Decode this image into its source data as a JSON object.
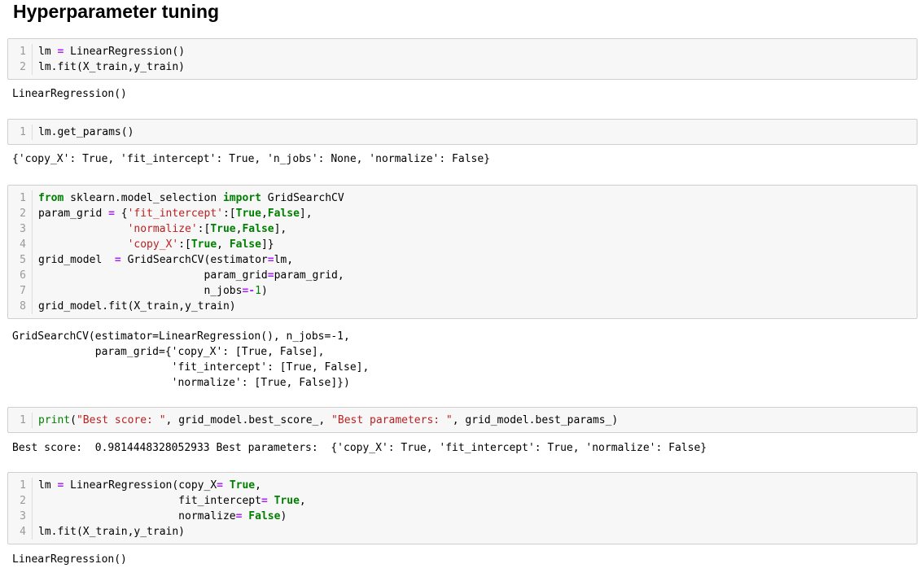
{
  "title": "Hyperparameter tuning",
  "cells": [
    {
      "lines": [
        [
          [
            "lm ",
            ""
          ],
          [
            "=",
            "op"
          ],
          [
            " LinearRegression()",
            ""
          ]
        ],
        [
          [
            "lm.fit(X_train,y_train)",
            ""
          ]
        ]
      ],
      "output": "LinearRegression()"
    },
    {
      "lines": [
        [
          [
            "lm.get_params()",
            ""
          ]
        ]
      ],
      "output": "{'copy_X': True, 'fit_intercept': True, 'n_jobs': None, 'normalize': False}"
    },
    {
      "lines": [
        [
          [
            "from",
            "kw"
          ],
          [
            " sklearn.model_selection ",
            ""
          ],
          [
            "import",
            "kw"
          ],
          [
            " GridSearchCV",
            ""
          ]
        ],
        [
          [
            "param_grid ",
            ""
          ],
          [
            "=",
            "op"
          ],
          [
            " {",
            ""
          ],
          [
            "'fit_intercept'",
            "str"
          ],
          [
            ":[",
            ""
          ],
          [
            "True",
            "kw"
          ],
          [
            ",",
            ""
          ],
          [
            "False",
            "kw"
          ],
          [
            "],",
            ""
          ]
        ],
        [
          [
            "              ",
            ""
          ],
          [
            "'normalize'",
            "str"
          ],
          [
            ":[",
            ""
          ],
          [
            "True",
            "kw"
          ],
          [
            ",",
            ""
          ],
          [
            "False",
            "kw"
          ],
          [
            "],",
            ""
          ]
        ],
        [
          [
            "              ",
            ""
          ],
          [
            "'copy_X'",
            "str"
          ],
          [
            ":[",
            ""
          ],
          [
            "True",
            "kw"
          ],
          [
            ", ",
            ""
          ],
          [
            "False",
            "kw"
          ],
          [
            "]}",
            ""
          ]
        ],
        [
          [
            "grid_model  ",
            ""
          ],
          [
            "=",
            "op"
          ],
          [
            " GridSearchCV(estimator",
            ""
          ],
          [
            "=",
            "op"
          ],
          [
            "lm,",
            ""
          ]
        ],
        [
          [
            "                          param_grid",
            ""
          ],
          [
            "=",
            "op"
          ],
          [
            "param_grid,",
            ""
          ]
        ],
        [
          [
            "                          n_jobs",
            ""
          ],
          [
            "=-",
            "op"
          ],
          [
            "1",
            "num"
          ],
          [
            ")",
            ""
          ]
        ],
        [
          [
            "grid_model.fit(X_train,y_train)",
            ""
          ]
        ]
      ],
      "output": "GridSearchCV(estimator=LinearRegression(), n_jobs=-1,\n             param_grid={'copy_X': [True, False],\n                         'fit_intercept': [True, False],\n                         'normalize': [True, False]})"
    },
    {
      "lines": [
        [
          [
            "print",
            "bi"
          ],
          [
            "(",
            ""
          ],
          [
            "\"Best score: \"",
            "str"
          ],
          [
            ", grid_model.best_score_, ",
            ""
          ],
          [
            "\"Best parameters: \"",
            "str"
          ],
          [
            ", grid_model.best_params_)",
            ""
          ]
        ]
      ],
      "output": "Best score:  0.9814448328052933 Best parameters:  {'copy_X': True, 'fit_intercept': True, 'normalize': False}"
    },
    {
      "lines": [
        [
          [
            "lm ",
            ""
          ],
          [
            "=",
            "op"
          ],
          [
            " LinearRegression(copy_X",
            ""
          ],
          [
            "=",
            "op"
          ],
          [
            " ",
            ""
          ],
          [
            "True",
            "kw"
          ],
          [
            ",",
            ""
          ]
        ],
        [
          [
            "                      fit_intercept",
            ""
          ],
          [
            "=",
            "op"
          ],
          [
            " ",
            ""
          ],
          [
            "True",
            "kw"
          ],
          [
            ",",
            ""
          ]
        ],
        [
          [
            "                      normalize",
            ""
          ],
          [
            "=",
            "op"
          ],
          [
            " ",
            ""
          ],
          [
            "False",
            "kw"
          ],
          [
            ")",
            ""
          ]
        ],
        [
          [
            "lm.fit(X_train,y_train)",
            ""
          ]
        ]
      ],
      "output": "LinearRegression()"
    }
  ]
}
